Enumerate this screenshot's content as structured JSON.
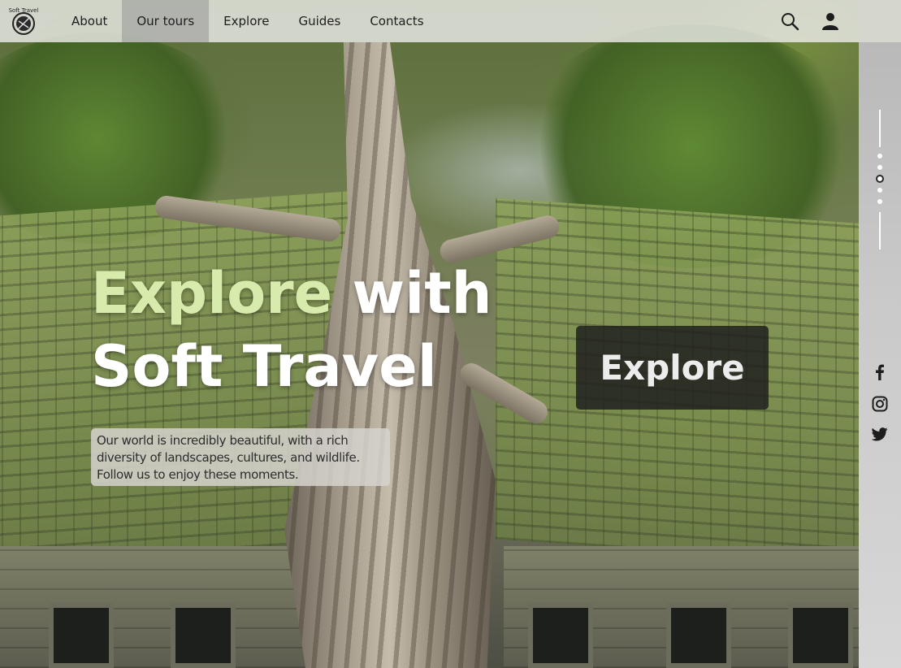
{
  "brand": {
    "logo_text": "Soft Travel"
  },
  "nav": {
    "items": [
      {
        "label": "About",
        "active": false
      },
      {
        "label": "Our tours",
        "active": true
      },
      {
        "label": "Explore",
        "active": false
      },
      {
        "label": "Guides",
        "active": false
      },
      {
        "label": "Contacts",
        "active": false
      }
    ],
    "icons": [
      "search-icon",
      "user-icon"
    ]
  },
  "hero": {
    "headline_accent": "Explore",
    "headline_rest": " with",
    "headline_line2": "Soft Travel",
    "tagline_lines": [
      "Our world is incredibly beautiful, with a rich",
      "diversity of landscapes, cultures, and wildlife.",
      "Follow us to enjoy these moments."
    ],
    "cta_label": "Explore"
  },
  "pager": {
    "count": 5,
    "active_index": 2
  },
  "social": [
    "facebook-icon",
    "instagram-icon",
    "twitter-icon"
  ],
  "colors": {
    "accent": "#d7ecac",
    "nav_bg": "#ebebe8",
    "nav_active": "#969696",
    "cta_bg": "#20201e",
    "rail_bg": "#c9c9c9"
  }
}
